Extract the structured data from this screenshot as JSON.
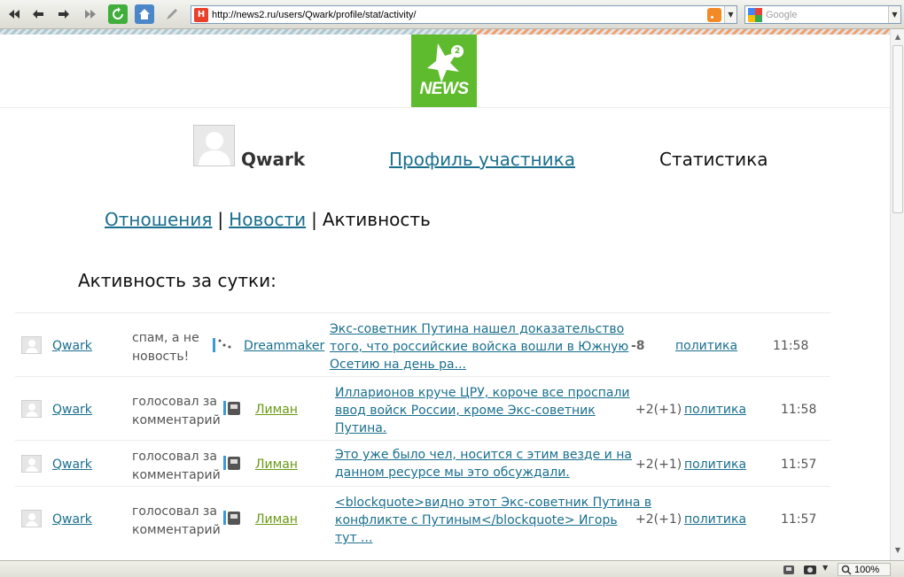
{
  "browser": {
    "url": "http://news2.ru/users/Qwark/profile/stat/activity/",
    "search_placeholder": "Google",
    "zoom": "100%"
  },
  "logo": {
    "word": "NEWS",
    "number": "2"
  },
  "profile": {
    "username": "Qwark",
    "nav_profile": "Профиль участника",
    "nav_stat": "Статистика"
  },
  "subnav": {
    "relations": "Отношения",
    "news": "Новости",
    "activity": "Активность",
    "separator": "|"
  },
  "section_title": "Активность за сутки:",
  "activity": [
    {
      "user": "Qwark",
      "action_line1": "спам, а не",
      "action_line2": "новость!",
      "target": "Dreammaker",
      "title_lines": [
        "Экс-советник Путина нашел доказательство",
        "того, что российские войска вошли в Южную",
        "Осетию на день ра..."
      ],
      "score": "-8",
      "category": "политика",
      "time": "11:58"
    },
    {
      "user": "Qwark",
      "action_line1": "голосовал за",
      "action_line2": "комментарий",
      "target": "Лиман",
      "title_lines": [
        "Илларионов круче ЦРУ, короче все проспали",
        "ввод войск России, кроме Экс-советник",
        "Путина."
      ],
      "score": "+2(+1)",
      "category": "политика",
      "time": "11:58"
    },
    {
      "user": "Qwark",
      "action_line1": "голосовал за",
      "action_line2": "комментарий",
      "target": "Лиман",
      "title_lines": [
        "Это уже было чел, носится с этим везде и на",
        "данном ресурсе мы это обсуждали."
      ],
      "score": "+2(+1)",
      "category": "политика",
      "time": "11:57"
    },
    {
      "user": "Qwark",
      "action_line1": "голосовал за",
      "action_line2": "комментарий",
      "target": "Лиман",
      "title_lines": [
        "<blockquote>видно этот Экс-советник Путина в",
        "конфликте с Путиным</blockquote> Игорь",
        "тут ..."
      ],
      "score": "+2(+1)",
      "category": "политика",
      "time": "11:57"
    }
  ]
}
